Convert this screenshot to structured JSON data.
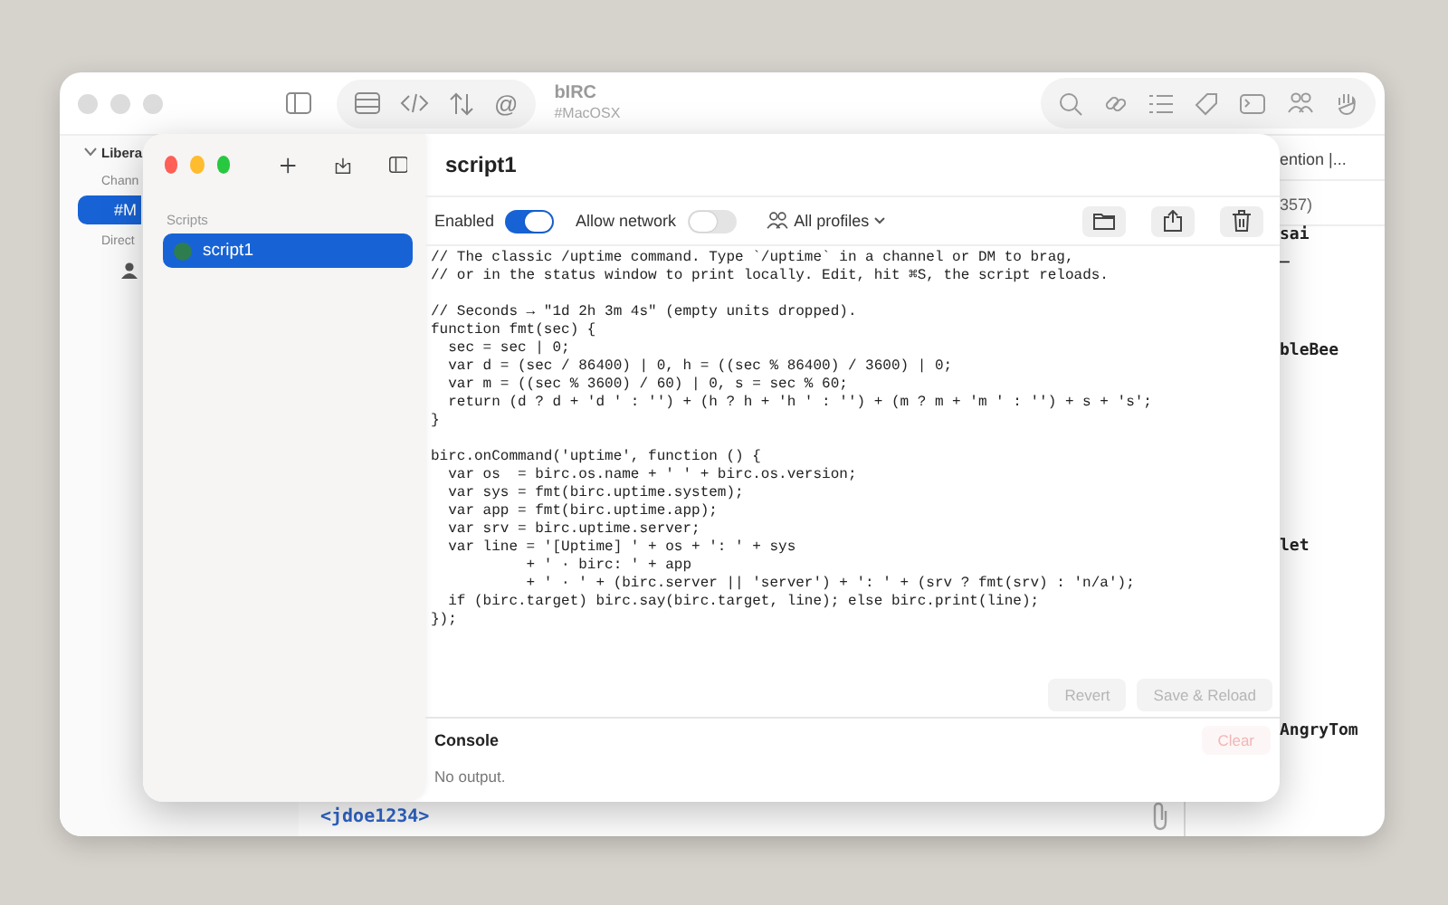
{
  "main_window": {
    "mention_symbol": "@",
    "title": "bIRC",
    "subtitle": "#MacOSX",
    "sidebar": {
      "network": "Libera",
      "expanded": true,
      "sections": [
        {
          "kind": "header",
          "label": "Chann"
        },
        {
          "kind": "channel",
          "label": "#M",
          "selected": true
        },
        {
          "kind": "header",
          "label": "Direct"
        },
        {
          "kind": "person"
        }
      ]
    },
    "topic": "ention |...",
    "user_count": "357)",
    "users": [
      "sai",
      "_",
      "bleBee",
      "let",
      "AngryTom"
    ],
    "input_nick": "<jdoe1234>"
  },
  "scripts_window": {
    "sidebar_heading": "Scripts",
    "scripts": [
      {
        "name": "script1",
        "selected": true,
        "color": "#2e7d4f"
      }
    ],
    "title": "script1",
    "enabled": {
      "label": "Enabled",
      "on": true
    },
    "allow_network": {
      "label": "Allow network",
      "on": false
    },
    "profiles": "All profiles",
    "code": "// The classic /uptime command. Type `/uptime` in a channel or DM to brag,\n// or in the status window to print locally. Edit, hit ⌘S, the script reloads.\n\n// Seconds → \"1d 2h 3m 4s\" (empty units dropped).\nfunction fmt(sec) {\n  sec = sec | 0;\n  var d = (sec / 86400) | 0, h = ((sec % 86400) / 3600) | 0;\n  var m = ((sec % 3600) / 60) | 0, s = sec % 60;\n  return (d ? d + 'd ' : '') + (h ? h + 'h ' : '') + (m ? m + 'm ' : '') + s + 's';\n}\n\nbirc.onCommand('uptime', function () {\n  var os  = birc.os.name + ' ' + birc.os.version;\n  var sys = fmt(birc.uptime.system);\n  var app = fmt(birc.uptime.app);\n  var srv = birc.uptime.server;\n  var line = '[Uptime] ' + os + ': ' + sys\n           + ' · birc: ' + app\n           + ' · ' + (birc.server || 'server') + ': ' + (srv ? fmt(srv) : 'n/a');\n  if (birc.target) birc.say(birc.target, line); else birc.print(line);\n});",
    "buttons": [
      {
        "label": "Revert",
        "disabled": true
      },
      {
        "label": "Save & Reload",
        "disabled": true
      }
    ],
    "console": {
      "title": "Console",
      "clear": {
        "label": "Clear",
        "disabled": true
      },
      "output": "No output."
    }
  }
}
